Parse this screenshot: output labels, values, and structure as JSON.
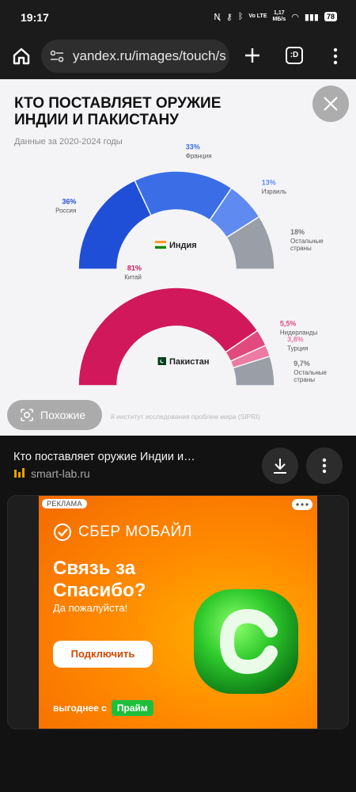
{
  "status_bar": {
    "time": "19:17",
    "net_speed_top": "1,17",
    "net_speed_bottom": "МБ/s",
    "volte": "Vo LTE",
    "battery": "78"
  },
  "toolbar": {
    "url": "yandex.ru/images/touch/s",
    "tabs_label": ":D"
  },
  "image": {
    "title_line1": "КТО ПОСТАВЛЯЕТ ОРУЖИЕ",
    "title_line2": "ИНДИИ И ПАКИСТАНУ",
    "subtitle": "Данные за 2020-2024 годы",
    "source": "й институт исследования проблем мира (SIPRI)",
    "similar_label": "Похожие"
  },
  "chart_data": [
    {
      "type": "pie",
      "subtype": "semicircle-donut",
      "title": "Индия",
      "categories": [
        "Россия",
        "Франция",
        "Израиль",
        "Остальные страны"
      ],
      "values": [
        36,
        33,
        13,
        18
      ],
      "value_labels": [
        "36%",
        "33%",
        "13%",
        "18%"
      ],
      "colors": [
        "#1f4fd6",
        "#3b6ee6",
        "#5f8bf0",
        "#9a9ea6"
      ]
    },
    {
      "type": "pie",
      "subtype": "semicircle-donut",
      "title": "Пакистан",
      "categories": [
        "Китай",
        "Нидерланды",
        "Турция",
        "Остальные страны"
      ],
      "values": [
        81,
        5.5,
        3.8,
        9.7
      ],
      "value_labels": [
        "81%",
        "5,5%",
        "3,8%",
        "9,7%"
      ],
      "colors": [
        "#d0185a",
        "#e04a7c",
        "#ec7aa2",
        "#9a9ea6"
      ]
    }
  ],
  "result": {
    "title": "Кто поставляет оружие Индии и…",
    "source": "smart-lab.ru"
  },
  "ad": {
    "label": "РЕКЛАМА",
    "brand": "СБЕР МОБАЙЛ",
    "headline": "Связь за Спасибо?",
    "subline": "Да пожалуйста!",
    "cta": "Подключить",
    "bottom_text": "выгоднее с",
    "prime": "Прайм",
    "colors": {
      "orange": "#ff8a00",
      "green": "#1dbf3a"
    }
  }
}
